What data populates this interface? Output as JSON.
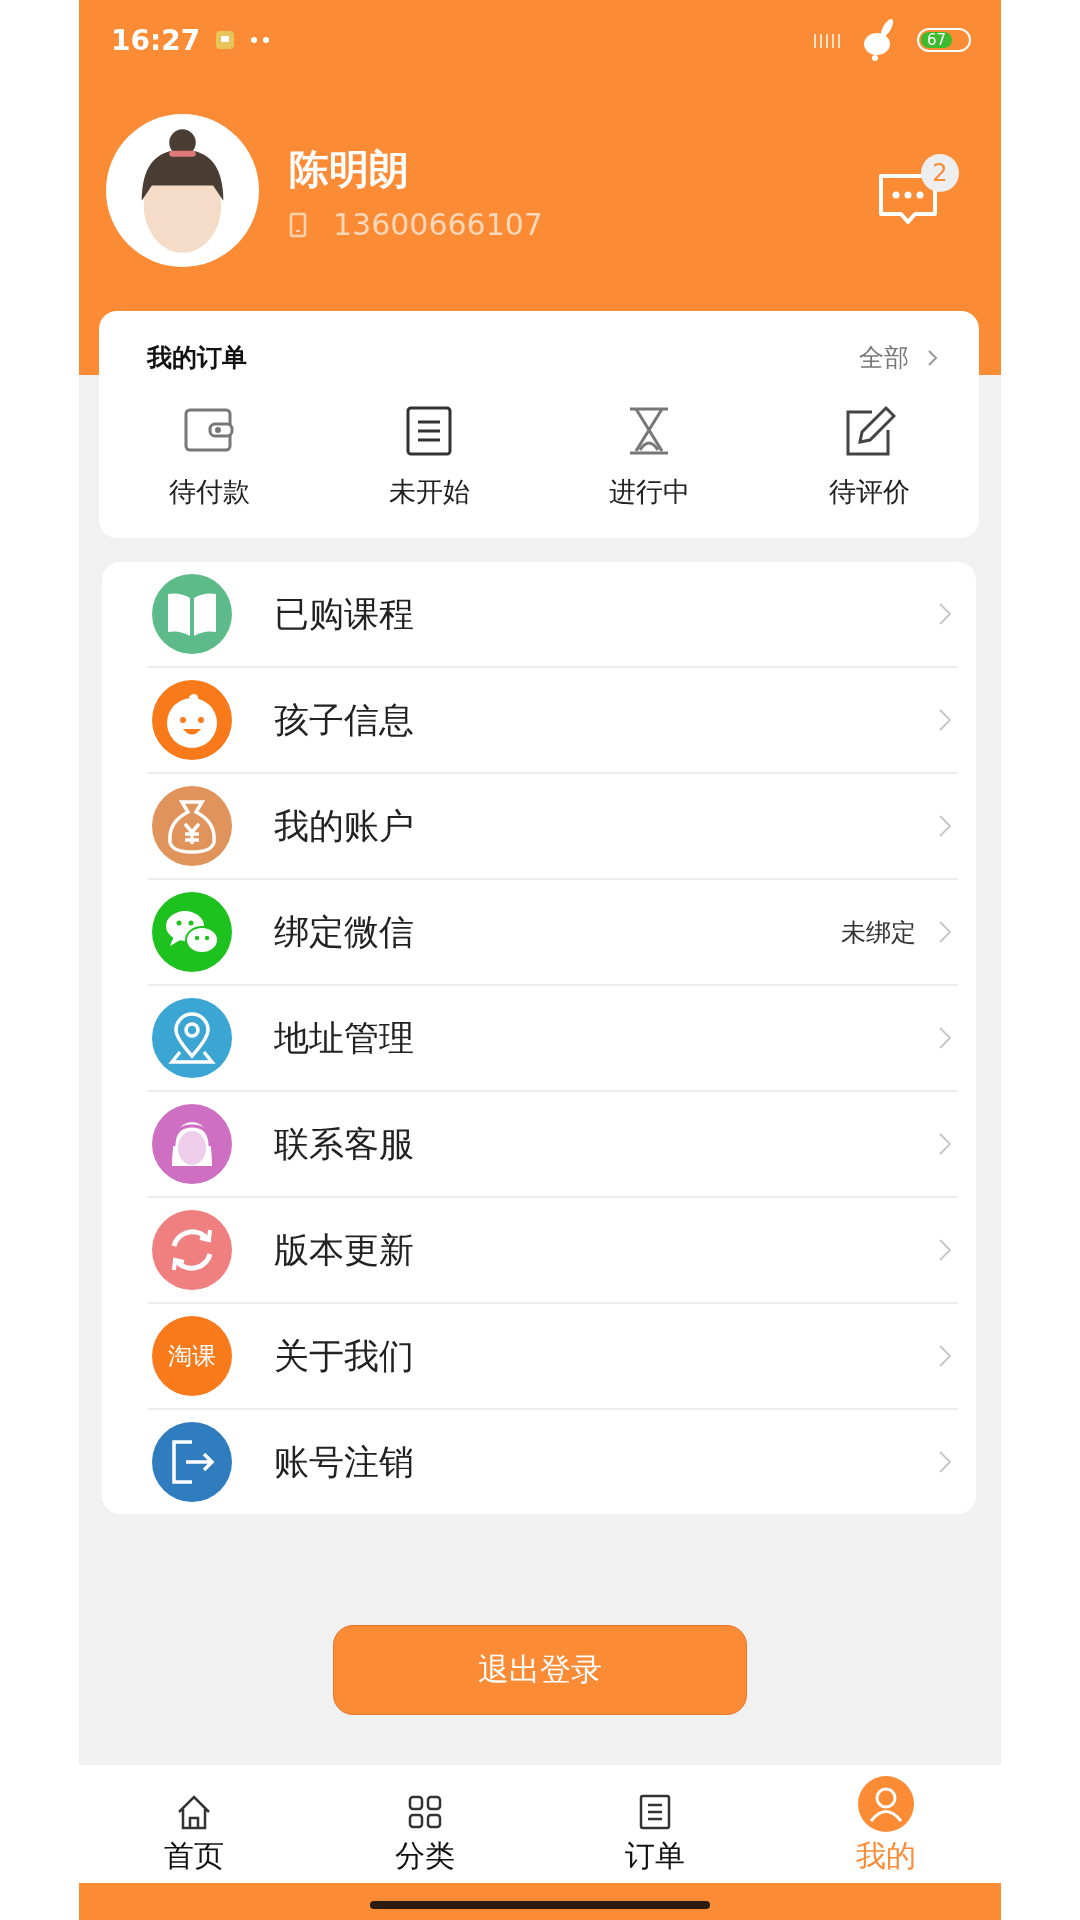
{
  "status_bar": {
    "time": "16:27",
    "battery": "67"
  },
  "profile": {
    "name": "陈明朗",
    "phone": "13600666107",
    "unread": "2"
  },
  "orders": {
    "title": "我的订单",
    "all_link": "全部",
    "items": [
      {
        "label": "待付款"
      },
      {
        "label": "未开始"
      },
      {
        "label": "进行中"
      },
      {
        "label": "待评价"
      }
    ]
  },
  "menu": [
    {
      "label": "已购课程"
    },
    {
      "label": "孩子信息"
    },
    {
      "label": "我的账户"
    },
    {
      "label": "绑定微信",
      "value": "未绑定"
    },
    {
      "label": "地址管理"
    },
    {
      "label": "联系客服"
    },
    {
      "label": "版本更新"
    },
    {
      "label": "关于我们",
      "icon_text": "淘课"
    },
    {
      "label": "账号注销"
    }
  ],
  "logout_button": "退出登录",
  "tab_bar": [
    {
      "label": "首页",
      "selected": false
    },
    {
      "label": "分类",
      "selected": false
    },
    {
      "label": "订单",
      "selected": false
    },
    {
      "label": "我的",
      "selected": true
    }
  ]
}
